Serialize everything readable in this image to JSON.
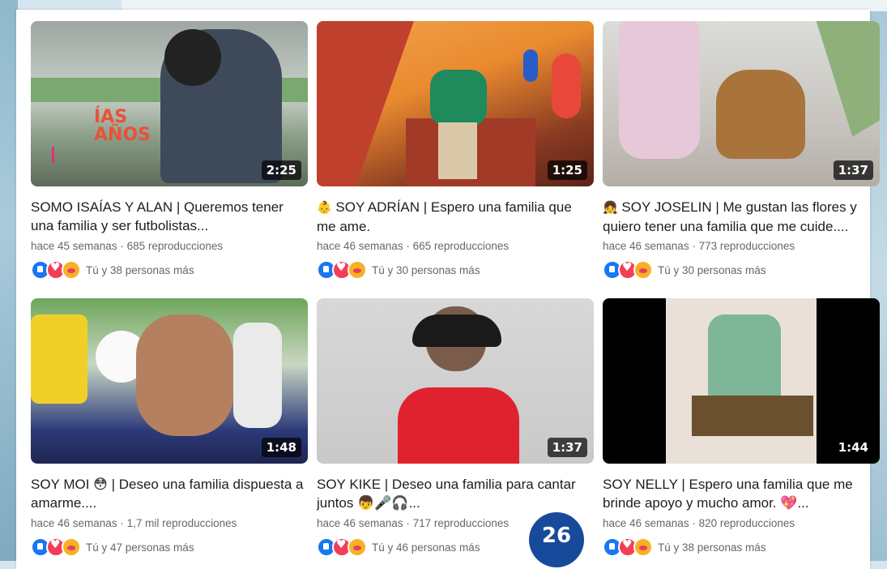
{
  "page_badge": "26",
  "videos": [
    {
      "title": "SOMO ISAÍAS Y ALAN | Queremos tener una familia y ser futbolistas...",
      "emoji": "",
      "duration": "2:25",
      "meta": "hace 45 semanas · 685 reproducciones",
      "reactions": "Tú y 38 personas más",
      "overlay_text": "ÍAS AÑOS"
    },
    {
      "title": "SOY ADRÍAN | Espero una familia que me ame.",
      "emoji": "👶",
      "duration": "1:25",
      "meta": "hace 46 semanas · 665 reproducciones",
      "reactions": "Tú y 30 personas más"
    },
    {
      "title": "SOY JOSELIN | Me gustan las flores y quiero tener una familia que me cuide....",
      "emoji": "👧",
      "duration": "1:37",
      "meta": "hace 46 semanas · 773 reproducciones",
      "reactions": "Tú y 30 personas más"
    },
    {
      "title": "SOY MOI 😳 | Deseo una familia dispuesta a amarme....",
      "emoji": "",
      "duration": "1:48",
      "meta": "hace 46 semanas · 1,7 mil reproducciones",
      "reactions": "Tú y 47 personas más"
    },
    {
      "title": "SOY KIKE | Deseo una familia para cantar juntos 👦🎤🎧...",
      "emoji": "",
      "duration": "1:37",
      "meta": "hace 46 semanas · 717 reproducciones",
      "reactions": "Tú y 46 personas más"
    },
    {
      "title": "SOY NELLY | Espero una familia que me brinde apoyo y mucho amor. 💖...",
      "emoji": "",
      "duration": "1:44",
      "meta": "hace 46 semanas · 820 reproducciones",
      "reactions": "Tú y 38 personas más"
    }
  ]
}
